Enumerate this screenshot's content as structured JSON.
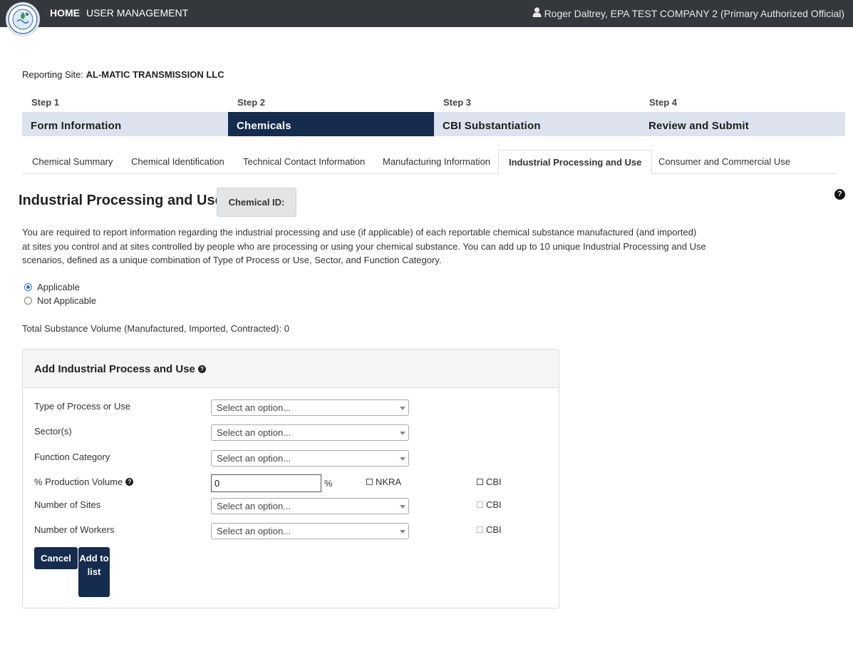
{
  "header": {
    "logo_icon": "epa-seal-icon",
    "nav": {
      "home": "HOME",
      "user_management": "USER MANAGEMENT"
    },
    "user_icon": "user-icon",
    "user_text": "Roger Daltrey, EPA TEST COMPANY 2 (Primary Authorized Official)"
  },
  "reporting_site": {
    "label": "Reporting Site:",
    "value": "AL-MATIC TRANSMISSION LLC"
  },
  "steps": [
    {
      "number": "Step 1",
      "title": "Form Information",
      "active": false
    },
    {
      "number": "Step 2",
      "title": "Chemicals",
      "active": true
    },
    {
      "number": "Step 3",
      "title": "CBI Substantiation",
      "active": false
    },
    {
      "number": "Step 4",
      "title": "Review and Submit",
      "active": false
    }
  ],
  "tabs": [
    "Chemical Summary",
    "Chemical Identification",
    "Technical Contact Information",
    "Manufacturing Information",
    "Industrial Processing and Use",
    "Consumer and Commercial Use"
  ],
  "active_tab": "Industrial Processing and Use",
  "page": {
    "title": "Industrial Processing and Use",
    "chemical_id_label": "Chemical ID:",
    "help_icon": "question-circle-icon",
    "intro_text": "You are required to report information regarding the industrial processing and use (if applicable) of each reportable chemical substance manufactured (and imported) at sites you control and at sites controlled by people who are processing or using your chemical substance. You can add up to 10 unique Industrial Processing and Use scenarios, defined as a unique combination of Type of Process or Use, Sector, and Function Category.",
    "applicability": {
      "options": [
        "Applicable",
        "Not Applicable"
      ],
      "selected": "Applicable"
    },
    "total_volume_label": "Total Substance Volume (Manufactured, Imported, Contracted): 0"
  },
  "panel": {
    "title": "Add Industrial Process and Use",
    "fields": {
      "type_of_process": {
        "label": "Type of Process or Use",
        "value": "Select an option..."
      },
      "sectors": {
        "label": "Sector(s)",
        "value": "Select an option..."
      },
      "function_category": {
        "label": "Function Category",
        "value": "Select an option..."
      },
      "production_volume": {
        "label": "% Production Volume",
        "value": "0",
        "unit": "%",
        "nkra_label": "NKRA",
        "cbi_label": "CBI"
      },
      "number_of_sites": {
        "label": "Number of Sites",
        "value": "Select an option...",
        "cbi_label": "CBI"
      },
      "number_of_workers": {
        "label": "Number of Workers",
        "value": "Select an option...",
        "cbi_label": "CBI"
      }
    },
    "buttons": {
      "cancel": "Cancel",
      "add": "Add to list"
    }
  },
  "colors": {
    "navbar": "#34383d",
    "primary": "#152c4e",
    "step_bar": "#dde3ee"
  }
}
